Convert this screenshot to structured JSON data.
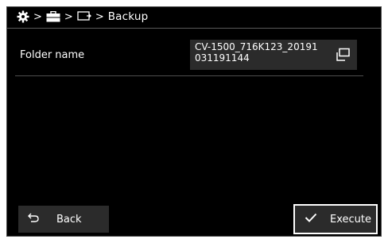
{
  "breadcrumb": {
    "icons": [
      "gear-icon",
      "toolbox-icon",
      "display-icon"
    ],
    "separator": ">",
    "current": "Backup"
  },
  "folder": {
    "label": "Folder name",
    "value": "CV-1500_716K123_20191031191144",
    "action_icon": "copy-icon"
  },
  "buttons": {
    "back_label": "Back",
    "back_icon": "undo-arrow-icon",
    "execute_label": "Execute",
    "execute_icon": "checkmark-icon"
  },
  "colors": {
    "background": "#000000",
    "panel": "#2b2b2b",
    "text": "#ffffff",
    "focus_border": "#ffffff"
  }
}
